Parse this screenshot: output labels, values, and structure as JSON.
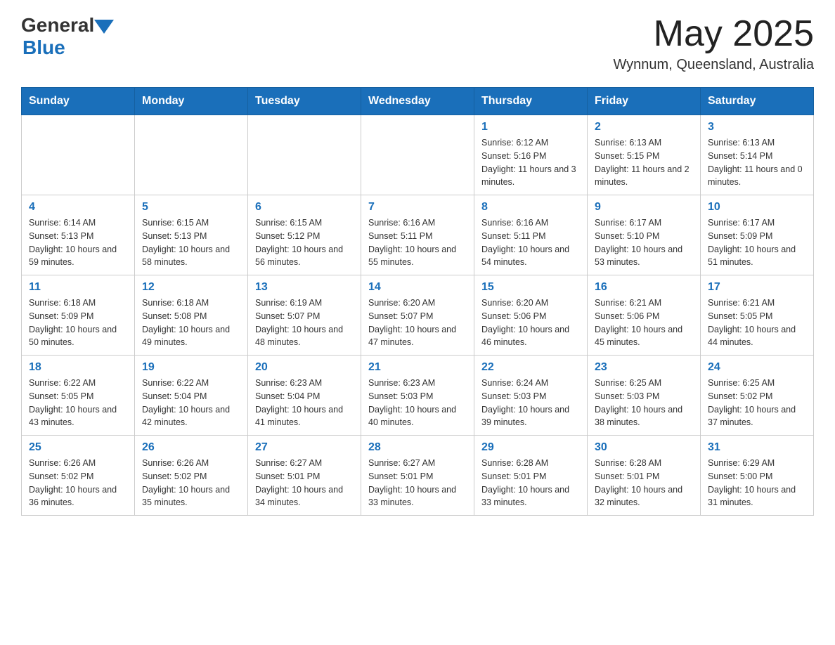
{
  "header": {
    "logo_general": "General",
    "logo_blue": "Blue",
    "month_year": "May 2025",
    "location": "Wynnum, Queensland, Australia"
  },
  "days_of_week": [
    "Sunday",
    "Monday",
    "Tuesday",
    "Wednesday",
    "Thursday",
    "Friday",
    "Saturday"
  ],
  "weeks": [
    [
      {
        "day": "",
        "info": ""
      },
      {
        "day": "",
        "info": ""
      },
      {
        "day": "",
        "info": ""
      },
      {
        "day": "",
        "info": ""
      },
      {
        "day": "1",
        "info": "Sunrise: 6:12 AM\nSunset: 5:16 PM\nDaylight: 11 hours and 3 minutes."
      },
      {
        "day": "2",
        "info": "Sunrise: 6:13 AM\nSunset: 5:15 PM\nDaylight: 11 hours and 2 minutes."
      },
      {
        "day": "3",
        "info": "Sunrise: 6:13 AM\nSunset: 5:14 PM\nDaylight: 11 hours and 0 minutes."
      }
    ],
    [
      {
        "day": "4",
        "info": "Sunrise: 6:14 AM\nSunset: 5:13 PM\nDaylight: 10 hours and 59 minutes."
      },
      {
        "day": "5",
        "info": "Sunrise: 6:15 AM\nSunset: 5:13 PM\nDaylight: 10 hours and 58 minutes."
      },
      {
        "day": "6",
        "info": "Sunrise: 6:15 AM\nSunset: 5:12 PM\nDaylight: 10 hours and 56 minutes."
      },
      {
        "day": "7",
        "info": "Sunrise: 6:16 AM\nSunset: 5:11 PM\nDaylight: 10 hours and 55 minutes."
      },
      {
        "day": "8",
        "info": "Sunrise: 6:16 AM\nSunset: 5:11 PM\nDaylight: 10 hours and 54 minutes."
      },
      {
        "day": "9",
        "info": "Sunrise: 6:17 AM\nSunset: 5:10 PM\nDaylight: 10 hours and 53 minutes."
      },
      {
        "day": "10",
        "info": "Sunrise: 6:17 AM\nSunset: 5:09 PM\nDaylight: 10 hours and 51 minutes."
      }
    ],
    [
      {
        "day": "11",
        "info": "Sunrise: 6:18 AM\nSunset: 5:09 PM\nDaylight: 10 hours and 50 minutes."
      },
      {
        "day": "12",
        "info": "Sunrise: 6:18 AM\nSunset: 5:08 PM\nDaylight: 10 hours and 49 minutes."
      },
      {
        "day": "13",
        "info": "Sunrise: 6:19 AM\nSunset: 5:07 PM\nDaylight: 10 hours and 48 minutes."
      },
      {
        "day": "14",
        "info": "Sunrise: 6:20 AM\nSunset: 5:07 PM\nDaylight: 10 hours and 47 minutes."
      },
      {
        "day": "15",
        "info": "Sunrise: 6:20 AM\nSunset: 5:06 PM\nDaylight: 10 hours and 46 minutes."
      },
      {
        "day": "16",
        "info": "Sunrise: 6:21 AM\nSunset: 5:06 PM\nDaylight: 10 hours and 45 minutes."
      },
      {
        "day": "17",
        "info": "Sunrise: 6:21 AM\nSunset: 5:05 PM\nDaylight: 10 hours and 44 minutes."
      }
    ],
    [
      {
        "day": "18",
        "info": "Sunrise: 6:22 AM\nSunset: 5:05 PM\nDaylight: 10 hours and 43 minutes."
      },
      {
        "day": "19",
        "info": "Sunrise: 6:22 AM\nSunset: 5:04 PM\nDaylight: 10 hours and 42 minutes."
      },
      {
        "day": "20",
        "info": "Sunrise: 6:23 AM\nSunset: 5:04 PM\nDaylight: 10 hours and 41 minutes."
      },
      {
        "day": "21",
        "info": "Sunrise: 6:23 AM\nSunset: 5:03 PM\nDaylight: 10 hours and 40 minutes."
      },
      {
        "day": "22",
        "info": "Sunrise: 6:24 AM\nSunset: 5:03 PM\nDaylight: 10 hours and 39 minutes."
      },
      {
        "day": "23",
        "info": "Sunrise: 6:25 AM\nSunset: 5:03 PM\nDaylight: 10 hours and 38 minutes."
      },
      {
        "day": "24",
        "info": "Sunrise: 6:25 AM\nSunset: 5:02 PM\nDaylight: 10 hours and 37 minutes."
      }
    ],
    [
      {
        "day": "25",
        "info": "Sunrise: 6:26 AM\nSunset: 5:02 PM\nDaylight: 10 hours and 36 minutes."
      },
      {
        "day": "26",
        "info": "Sunrise: 6:26 AM\nSunset: 5:02 PM\nDaylight: 10 hours and 35 minutes."
      },
      {
        "day": "27",
        "info": "Sunrise: 6:27 AM\nSunset: 5:01 PM\nDaylight: 10 hours and 34 minutes."
      },
      {
        "day": "28",
        "info": "Sunrise: 6:27 AM\nSunset: 5:01 PM\nDaylight: 10 hours and 33 minutes."
      },
      {
        "day": "29",
        "info": "Sunrise: 6:28 AM\nSunset: 5:01 PM\nDaylight: 10 hours and 33 minutes."
      },
      {
        "day": "30",
        "info": "Sunrise: 6:28 AM\nSunset: 5:01 PM\nDaylight: 10 hours and 32 minutes."
      },
      {
        "day": "31",
        "info": "Sunrise: 6:29 AM\nSunset: 5:00 PM\nDaylight: 10 hours and 31 minutes."
      }
    ]
  ]
}
